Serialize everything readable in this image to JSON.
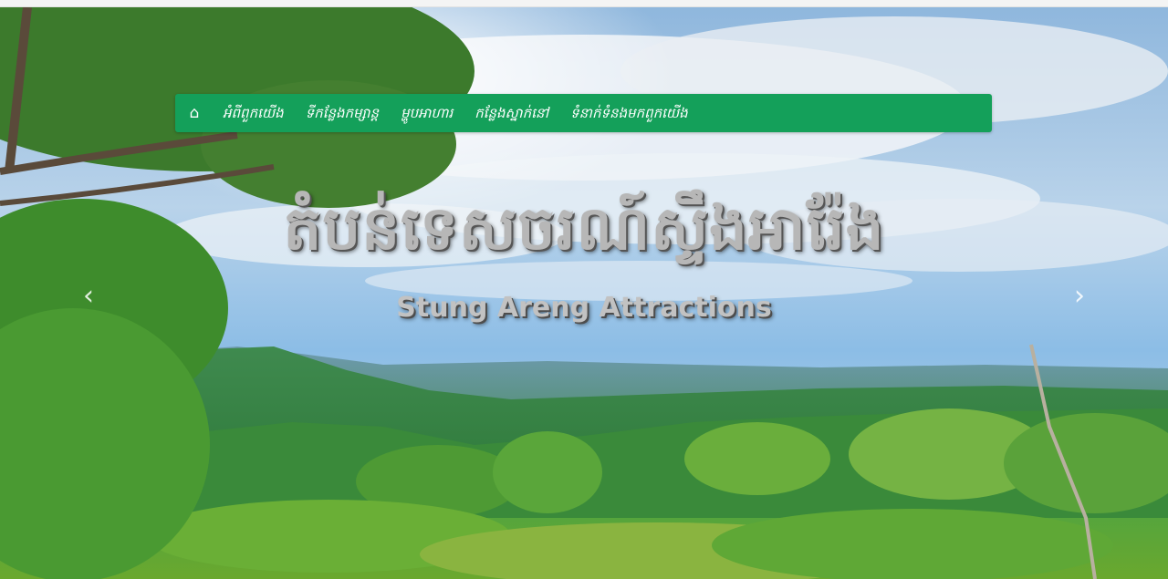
{
  "nav": {
    "home_icon": "home-icon",
    "items": [
      {
        "label": "អំពីពួកយើង"
      },
      {
        "label": "ទីកន្លែងកម្សាន្ត"
      },
      {
        "label": "ម្ហូបអាហារ"
      },
      {
        "label": "កន្លែងស្នាក់នៅ"
      },
      {
        "label": "ទំនាក់ទំនងមកពួកយើង"
      }
    ]
  },
  "hero": {
    "title_kh": "តំបន់ទេសចរណ៍ស្ទឹងអារ៉ែង",
    "title_en": "Stung Areng Attractions"
  },
  "carousel": {
    "prev_icon": "chevron-left-icon",
    "next_icon": "chevron-right-icon"
  },
  "colors": {
    "nav_bg": "#14a05a",
    "title_fill": "#b7b7b7"
  }
}
